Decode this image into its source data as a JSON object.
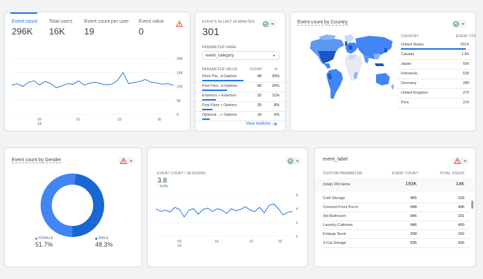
{
  "colors": {
    "accent": "#1a73e8",
    "warning": "#ea4335",
    "success": "#188038",
    "dark_blue": "#1967d2",
    "mid_blue": "#4285f4"
  },
  "card1": {
    "metrics": [
      {
        "label": "Event count",
        "value": "296K"
      },
      {
        "label": "Total users",
        "value": "16K"
      },
      {
        "label": "Event count per user",
        "value": "19"
      },
      {
        "label": "Event value",
        "value": "0"
      }
    ],
    "icon": "warning-triangle-icon",
    "y_ticks": [
      "20K",
      "15K",
      "10K",
      "5K",
      "0"
    ],
    "x_ticks": [
      "09",
      "16",
      "23",
      "30"
    ],
    "x_month": "Jul",
    "series": [
      10.5,
      11,
      10,
      11.5,
      12,
      10.5,
      11.8,
      11,
      9.5,
      10.2,
      11,
      10.8,
      12,
      10.5,
      11.2,
      11.5,
      11,
      10.6,
      10.8,
      12.2,
      15,
      11,
      11.4,
      11.8,
      12.5,
      11.5,
      11.3,
      10.8,
      11,
      10.5
    ]
  },
  "card2": {
    "title": "EVENTS IN LAST 30 MINUTES",
    "total": "301",
    "param_label": "PARAMETER NAME",
    "param_value": "event_category",
    "col_param": "PARAMETER VALUE",
    "col_count": "COUNT",
    "col_pct": "%",
    "rows": [
      {
        "name": "Floor Pla...d Options",
        "count": "98",
        "pct": "33%",
        "share": 0.33
      },
      {
        "name": "First Floo...d Options",
        "count": "60",
        "pct": "20%",
        "share": 0.2
      },
      {
        "name": "Exteriors > Exteriors",
        "count": "32",
        "pct": "11%",
        "share": 0.11
      },
      {
        "name": "First Floor > Options",
        "count": "25",
        "pct": "8%",
        "share": 0.08
      },
      {
        "name": "Optional ...> Options",
        "count": "18",
        "pct": "6%",
        "share": 0.06
      }
    ],
    "link": "View realtime"
  },
  "card3": {
    "title": "Event count by Country",
    "col_country": "COUNTRY",
    "col_count": "EVENT COUNT",
    "rows": [
      {
        "name": "United States",
        "count": "291K"
      },
      {
        "name": "Canada",
        "count": "1.8K"
      },
      {
        "name": "Japan",
        "count": "556"
      },
      {
        "name": "Indonesia",
        "count": "530"
      },
      {
        "name": "Germany",
        "count": "289"
      },
      {
        "name": "United Kingdom",
        "count": "270"
      },
      {
        "name": "Peru",
        "count": "216"
      }
    ]
  },
  "card4": {
    "title": "Event count by Gender",
    "female_label": "FEMALE",
    "female_value": "51.7%",
    "female_share": 0.517,
    "male_label": "MALE",
    "male_value": "48.3%",
    "male_share": 0.483
  },
  "card5": {
    "title": "EVENT COUNT / SESSIONS",
    "value": "3.8",
    "delta": "↑ 4.9%",
    "y_ticks": [
      "6",
      "4",
      "2",
      "0"
    ],
    "x_ticks": [
      "09",
      "16",
      "23",
      "30"
    ],
    "x_month": "Jul",
    "series": [
      4.0,
      3.6,
      3.8,
      3.5,
      4.2,
      3.9,
      2.8,
      3.8,
      4.0,
      3.2,
      3.9,
      4.1,
      3.6,
      4.0,
      3.8,
      3.3,
      4.0,
      3.7,
      3.9,
      4.3,
      3.8,
      3.6,
      4.2,
      3.4,
      4.5,
      4.7,
      4.0,
      3.1,
      3.5,
      3.6
    ]
  },
  "card6": {
    "title": "event_label",
    "col_param": "CUSTOM PARAMETER",
    "col_count": "EVENT COUNT",
    "col_users": "TOTAL USERS",
    "total_label": "(total) 200 items",
    "total_count": "193K",
    "total_users": "14K",
    "rows": [
      {
        "name": "Cold Storage",
        "count": "865",
        "users": "318"
      },
      {
        "name": "Covered Front Porch",
        "count": "848",
        "users": "496"
      },
      {
        "name": "3rd Bathroom",
        "count": "846",
        "users": "331"
      },
      {
        "name": "Laundry Cabinets",
        "count": "846",
        "users": "400"
      },
      {
        "name": "Enlarge Nook",
        "count": "838",
        "users": "316"
      },
      {
        "name": "3-Car Garage",
        "count": "835",
        "users": "425"
      }
    ]
  }
}
